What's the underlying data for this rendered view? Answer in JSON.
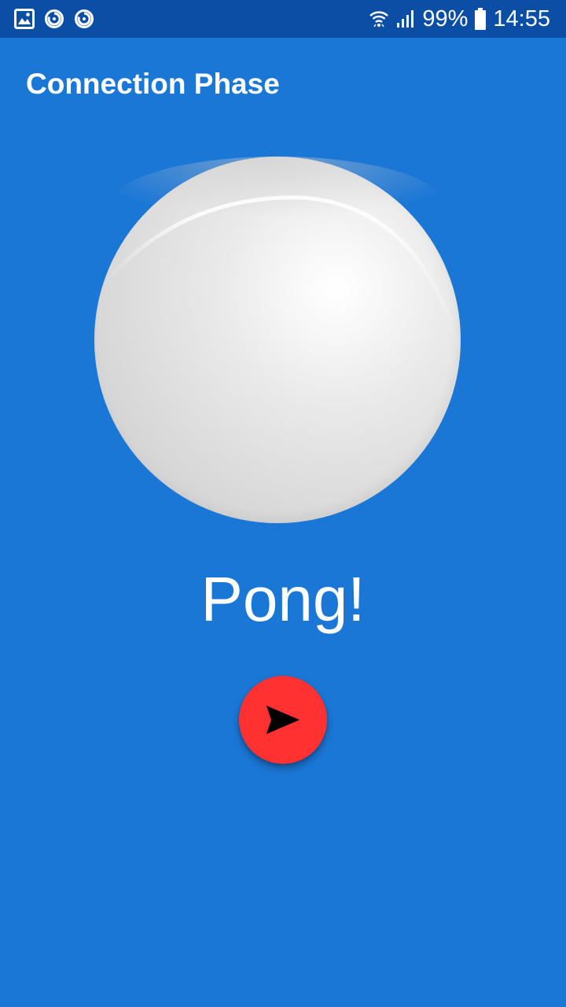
{
  "status_bar": {
    "left_icons": [
      "gallery-icon",
      "sync-icon",
      "sync-icon"
    ],
    "battery_percent": "99%",
    "time": "14:55",
    "right_icons": [
      "wifi-icon",
      "signal-icon",
      "battery-icon"
    ]
  },
  "app_bar": {
    "title": "Connection Phase"
  },
  "main": {
    "ball_image": "ping-pong-ball",
    "status_text": "Pong!",
    "fab_icon": "send-icon"
  },
  "colors": {
    "background": "#1b77d6",
    "status_bar": "#0b4ea6",
    "fab": "#ff3131",
    "text": "#ffffff"
  }
}
